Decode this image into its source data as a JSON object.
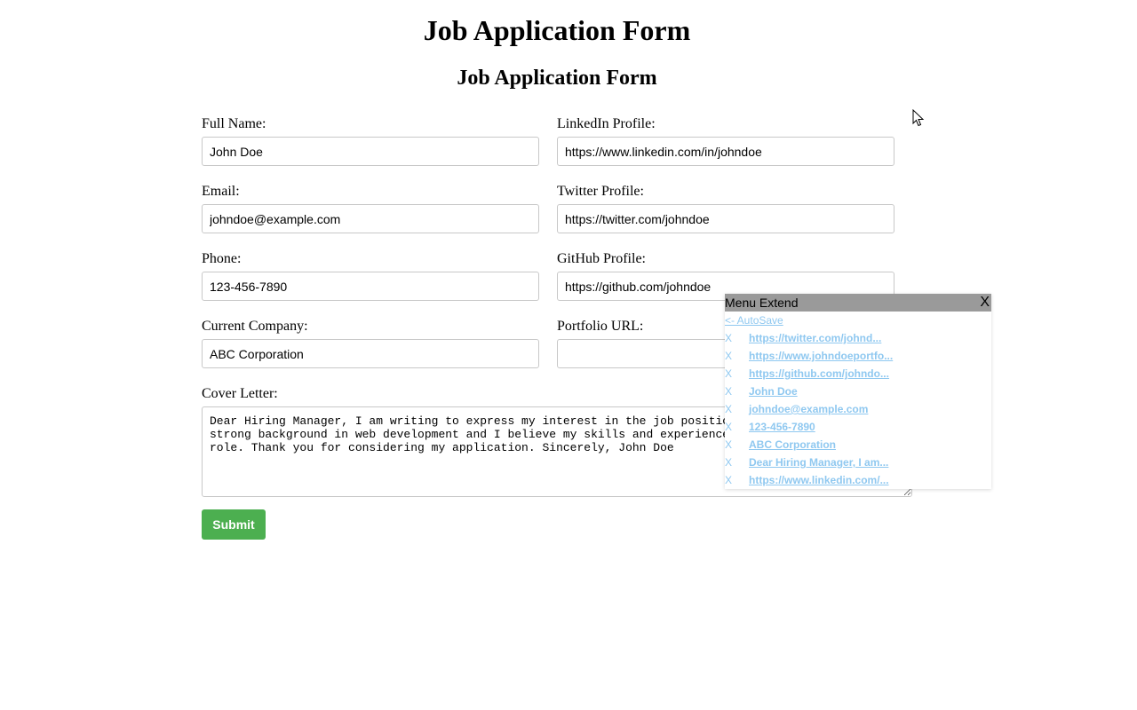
{
  "page": {
    "title": "Job Application Form",
    "form_title": "Job Application Form"
  },
  "form": {
    "full_name": {
      "label": "Full Name:",
      "value": "John Doe"
    },
    "email": {
      "label": "Email:",
      "value": "johndoe@example.com"
    },
    "phone": {
      "label": "Phone:",
      "value": "123-456-7890"
    },
    "current_company": {
      "label": "Current Company:",
      "value": "ABC Corporation"
    },
    "linkedin": {
      "label": "LinkedIn Profile:",
      "value": "https://www.linkedin.com/in/johndoe"
    },
    "twitter": {
      "label": "Twitter Profile:",
      "value": "https://twitter.com/johndoe"
    },
    "github": {
      "label": "GitHub Profile:",
      "value": "https://github.com/johndoe"
    },
    "portfolio": {
      "label": "Portfolio URL:",
      "value": ""
    },
    "cover_letter": {
      "label": "Cover Letter:",
      "value": "Dear Hiring Manager, I am writing to express my interest in the job position at\nstrong background in web development and I believe my skills and experience mak\nrole. Thank you for considering my application. Sincerely, John Doe"
    },
    "submit_label": "Submit"
  },
  "menu_extend": {
    "title": "Menu Extend",
    "close_label": "X",
    "back_label": "<- AutoSave",
    "remove_label": "X",
    "items": [
      "https://twitter.com/johnd...",
      "https://www.johndoeportfo...",
      "https://github.com/johndo...",
      "John Doe",
      "johndoe@example.com",
      "123-456-7890",
      "ABC Corporation",
      "Dear Hiring Manager, I am...",
      "https://www.linkedin.com/..."
    ]
  },
  "colors": {
    "submit_bg": "#4caf50",
    "menu_header_bg": "#9a9a9a",
    "menu_link": "#8fc8f0"
  }
}
